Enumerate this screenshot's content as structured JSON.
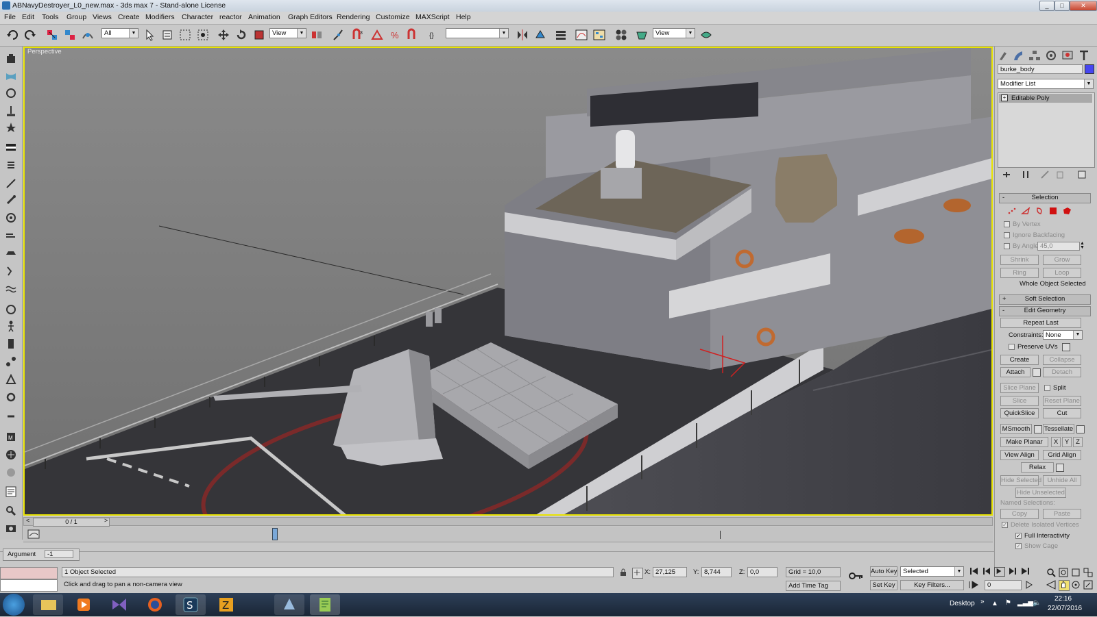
{
  "window": {
    "title": "ABNavyDestroyer_L0_new.max - 3ds max 7 - Stand-alone License",
    "minimize": "_",
    "maximize": "□",
    "close": "✕"
  },
  "menu": [
    "File",
    "Edit",
    "Tools",
    "Group",
    "Views",
    "Create",
    "Modifiers",
    "Character",
    "reactor",
    "Animation",
    "Graph Editors",
    "Rendering",
    "Customize",
    "MAXScript",
    "Help"
  ],
  "toolbar": {
    "selection_filter": "All",
    "ref_coord": "View",
    "named_selection": "",
    "render_view": "View"
  },
  "viewport": {
    "label": "Perspective",
    "colors": {
      "active_border": "#e8e300",
      "background": "#7e7e7e"
    }
  },
  "timeline": {
    "frame": "0 / 1",
    "prev": "<",
    "next": ">"
  },
  "command_panel": {
    "object_name": "burke_body",
    "object_color": "#4646f0",
    "modifier_list": "Modifier List",
    "stack_item": "Editable Poly",
    "selection": {
      "title": "Selection",
      "by_vertex": "By Vertex",
      "ignore_backfacing": "Ignore Backfacing",
      "by_angle": "By Angle:",
      "angle_value": "45,0",
      "shrink": "Shrink",
      "grow": "Grow",
      "ring": "Ring",
      "loop": "Loop",
      "status": "Whole Object Selected"
    },
    "soft_selection": "Soft Selection",
    "edit_geometry": {
      "title": "Edit Geometry",
      "repeat_last": "Repeat Last",
      "constraints_label": "Constraints:",
      "constraints_value": "None",
      "preserve_uvs": "Preserve UVs",
      "create": "Create",
      "collapse": "Collapse",
      "attach": "Attach",
      "detach": "Detach",
      "slice_plane": "Slice Plane",
      "split": "Split",
      "slice": "Slice",
      "reset_plane": "Reset Plane",
      "quickslice": "QuickSlice",
      "cut": "Cut",
      "msmooth": "MSmooth",
      "tessellate": "Tessellate",
      "make_planar": "Make Planar",
      "x": "X",
      "y": "Y",
      "z": "Z",
      "view_align": "View Align",
      "grid_align": "Grid Align",
      "relax": "Relax",
      "hide_selected": "Hide Selected",
      "unhide_all": "Unhide All",
      "hide_unselected": "Hide Unselected",
      "named_selections": "Named Selections:",
      "copy": "Copy",
      "paste": "Paste",
      "delete_isolated": "Delete Isolated Vertices",
      "full_interactivity": "Full Interactivity",
      "show_cage": "Show Cage"
    }
  },
  "status": {
    "argument_label": "Argument",
    "argument_value": "-1",
    "objects_selected": "1 Object Selected",
    "prompt": "Click and drag to pan a non-camera view",
    "x_label": "X:",
    "x_value": "27,125",
    "y_label": "Y:",
    "y_value": "8,744",
    "z_label": "Z:",
    "z_value": "0,0",
    "grid": "Grid = 10,0",
    "add_time_tag": "Add Time Tag",
    "auto_key": "Auto Key",
    "set_key": "Set Key",
    "key_mode": "Selected",
    "key_filters": "Key Filters...",
    "current_frame": "0"
  },
  "taskbar": {
    "desktop": "Desktop",
    "time": "22:16",
    "date": "22/07/2016"
  }
}
